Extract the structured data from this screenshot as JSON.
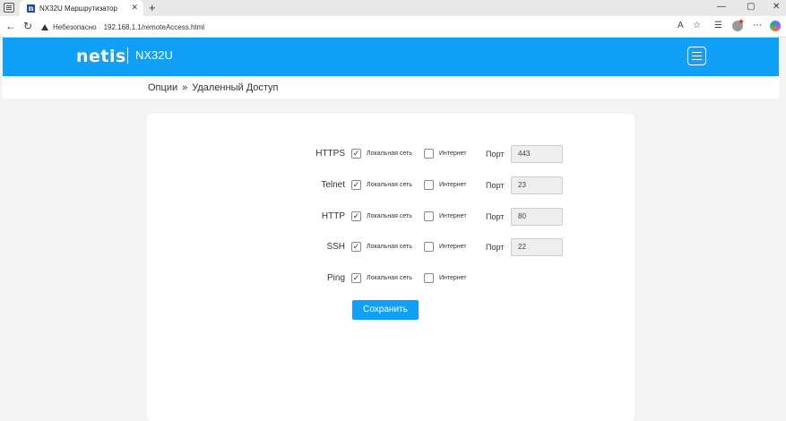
{
  "browser": {
    "tab_title": "NX32U Маршрутизатор",
    "tab_favicon": "n",
    "new_tab": "+",
    "insecure_label": "Небезопасно",
    "url": "192.168.1.1/remoteAccess.html",
    "back": "←",
    "reload": "↻",
    "tab_close": "✕",
    "win_min": "—",
    "win_max": "▢",
    "win_close": "✕"
  },
  "header": {
    "logo": "netis",
    "model": "NX32U"
  },
  "breadcrumb": {
    "parent": "Опции",
    "separator": "»",
    "current": "Удаленный Доступ"
  },
  "form": {
    "lan_label": "Локальная сеть",
    "wan_label": "Интернет",
    "port_label": "Порт",
    "rows": [
      {
        "name": "HTTPS",
        "lan_checked": true,
        "wan_checked": false,
        "port": "443"
      },
      {
        "name": "Telnet",
        "lan_checked": true,
        "wan_checked": false,
        "port": "23"
      },
      {
        "name": "HTTP",
        "lan_checked": true,
        "wan_checked": false,
        "port": "80"
      },
      {
        "name": "SSH",
        "lan_checked": true,
        "wan_checked": false,
        "port": "22"
      },
      {
        "name": "Ping",
        "lan_checked": true,
        "wan_checked": false
      }
    ],
    "save_label": "Сохранить"
  },
  "colors": {
    "brand": "#10a0f8"
  },
  "icons": [
    "tab-actions-icon",
    "back-icon",
    "reload-icon",
    "warning-icon",
    "read-aloud-icon",
    "favorite-icon",
    "favorites-icon",
    "profile-icon",
    "copilot-icon",
    "menu-icon",
    "check-icon"
  ]
}
